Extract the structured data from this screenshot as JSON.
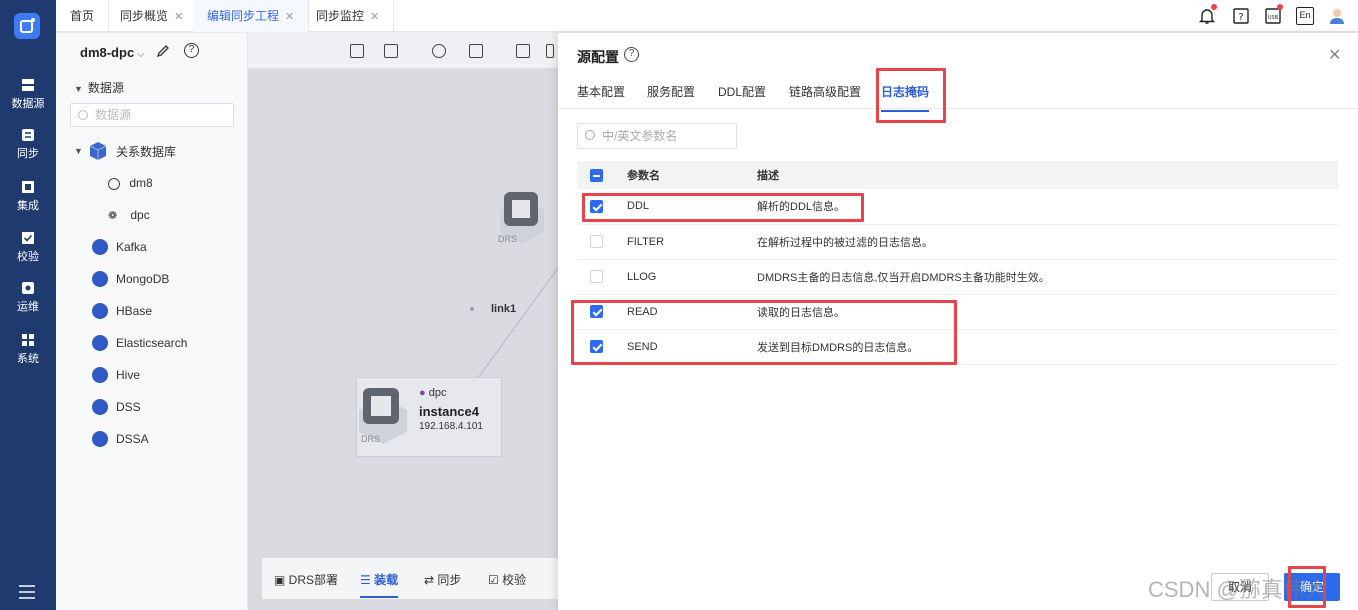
{
  "rail": {
    "items": [
      {
        "label": "数据源",
        "icon": "database-icon"
      },
      {
        "label": "同步",
        "icon": "sync-icon"
      },
      {
        "label": "集成",
        "icon": "integration-icon"
      },
      {
        "label": "校验",
        "icon": "check-icon"
      },
      {
        "label": "运维",
        "icon": "ops-icon"
      },
      {
        "label": "系统",
        "icon": "system-icon"
      }
    ]
  },
  "tabs": [
    {
      "label": "首页"
    },
    {
      "label": "同步概览",
      "close": "✕"
    },
    {
      "label": "编辑同步工程",
      "close": "✕",
      "active": true
    },
    {
      "label": "同步监控",
      "close": "✕"
    }
  ],
  "header": {
    "lang": "En",
    "usb": "USB"
  },
  "tree": {
    "project": "dm8-dpc",
    "section": "数据源",
    "search_placeholder": "数据源",
    "root": "关系数据库",
    "children": [
      "dm8",
      "dpc"
    ],
    "sources": [
      "Kafka",
      "MongoDB",
      "HBase",
      "Elasticsearch",
      "Hive",
      "DSS",
      "DSSA"
    ]
  },
  "canvas": {
    "link_label": "link1",
    "instance": {
      "db": "dpc",
      "name": "instance4",
      "ip": "192.168.4.101",
      "badge": "DRS"
    },
    "instance_top_badge": "DRS",
    "bottom_tabs": [
      "DRS部署",
      "装载",
      "同步",
      "校验"
    ]
  },
  "drawer": {
    "title": "源配置",
    "help": "?",
    "close": "✕",
    "tabs": [
      "基本配置",
      "服务配置",
      "DDL配置",
      "链路高级配置",
      "日志掩码"
    ],
    "active_tab": "日志掩码",
    "search_placeholder": "中/英文参数名",
    "columns": {
      "name": "参数名",
      "desc": "描述"
    },
    "rows": [
      {
        "name": "DDL",
        "desc": "解析的DDL信息。",
        "checked": true
      },
      {
        "name": "FILTER",
        "desc": "在解析过程中的被过滤的日志信息。",
        "checked": false
      },
      {
        "name": "LLOG",
        "desc": "DMDRS主备的日志信息,仅当开启DMDRS主备功能时生效。",
        "checked": false
      },
      {
        "name": "READ",
        "desc": "读取的日志信息。",
        "checked": true
      },
      {
        "name": "SEND",
        "desc": "发送到目标DMDRS的日志信息。",
        "checked": true
      }
    ],
    "cancel": "取消",
    "ok": "确定"
  },
  "watermark": "CSDN @猕真伟大"
}
